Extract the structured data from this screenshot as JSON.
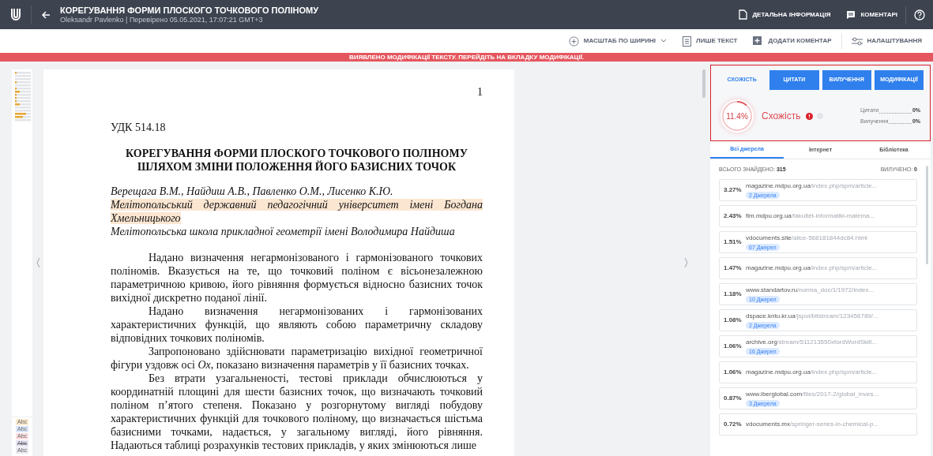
{
  "header": {
    "title": "КОРЕГУВАННЯ ФОРМИ ПЛОСКОГО ТОЧКОВОГО ПОЛІНОМУ",
    "subtitle": "Oleksandr Pavlenko | Перевірено 05.05.2021, 17:07:21 GMT+3",
    "actions": [
      "ДЕТАЛЬНА ІНФОРМАЦІЯ",
      "КОМЕНТАРІ"
    ]
  },
  "toolbar": [
    {
      "kind": "zoom",
      "label": "МАСШТАБ ПО ШИРИНІ"
    },
    {
      "kind": "text",
      "label": "ЛИШЕ ТЕКСТ"
    },
    {
      "kind": "comment",
      "label": "ДОДАТИ КОМЕНТАР"
    },
    {
      "kind": "settings",
      "label": "НАЛАШТУВАННЯ"
    }
  ],
  "banner": "ВИЯВЛЕНО МОДИФІКАЦІЇ ТЕКСТУ. ПЕРЕЙДІТЬ НА ВКЛАДКУ МОДИФІКАЦІЇ.",
  "legend": [
    {
      "label": "Abc",
      "kind": "similar"
    },
    {
      "label": "Abc",
      "kind": "quote"
    },
    {
      "label": "Abc",
      "kind": "modified"
    },
    {
      "label": "Abc",
      "kind": "excluded"
    },
    {
      "label": "Abc",
      "kind": "other"
    }
  ],
  "document": {
    "page_number": "1",
    "udc": "УДК 514.18",
    "title_lines": [
      "КОРЕГУВАННЯ ФОРМИ ПЛОСКОГО ТОЧКОВОГО ПОЛІНОМУ",
      "ШЛЯХОМ ЗМІНИ ПОЛОЖЕННЯ ЙОГО БАЗИСНИХ ТОЧОК"
    ],
    "affiliations": [
      {
        "text": "Верещага В.М., Найдиш А.В., Павленко О.М., Лисенко К.Ю.",
        "highlighted": false
      },
      {
        "text": "Мелітопольський державний педагогічний університет імені Богдана Хмельницького",
        "highlighted": true
      },
      {
        "text": "Мелітопольська школа прикладної геометрії імені Володимира Найдиша",
        "highlighted": false
      }
    ],
    "paragraphs": [
      "Надано визначення негармонізованого і гармонізованого точкових поліномів. Вказується на те, що точковий поліном є вісьонезалежною параметричною кривою, його рівняння формується відносно базисних точок вихідної дискретно поданої лінії.",
      "Надано визначення негармонізованих і гармонізованих характеристичних функцій, що являють собою параметричну складову відповідних точкових поліномів.",
      "Запропоновано здійснювати параметризацію вихідної геометричної фігури уздовж осі *Ox*, показано визначення параметрів у її базисних точках.",
      "Без втрати узагальненості, тестові приклади обчислюються у координатній площині для шести базисних точок, що визначають точковий поліном п’ятого степеня. Показано у розгорнутому вигляді побудову характеристичних функцій для точкового поліному, що визначається шістьма базисними точками, надається, у загальному вигляді, його рівняння. Надаються таблиці розрахунків тестових прикладів, у яких змінюються лише"
    ]
  },
  "report": {
    "tabs": [
      {
        "label": "СХОЖІСТЬ",
        "selected": true
      },
      {
        "label": "ЦИТАТИ",
        "selected": false
      },
      {
        "label": "ВИЛУЧЕННЯ",
        "selected": false
      },
      {
        "label": "МОДИФІКАЦІЇ",
        "selected": false
      }
    ],
    "score": {
      "value": "11.4%",
      "level": 0.114,
      "label": "Схожість"
    },
    "stats": [
      {
        "label": "Цитати",
        "value": "0%"
      },
      {
        "label": "Вилучення",
        "value": "0%"
      }
    ],
    "source_tabs": [
      {
        "label": "Всі джерела",
        "selected": true
      },
      {
        "label": "Інтернет",
        "selected": false
      },
      {
        "label": "Бібліотека",
        "selected": false
      }
    ],
    "found": {
      "label": "ВСЬОГО ЗНАЙДЕНО:",
      "value": "315"
    },
    "excluded": {
      "label": "ВИЛУЧЕНО:",
      "value": "0"
    },
    "sources": [
      {
        "percent": "3.27%",
        "domain": "magazine.mdpu.org.ua",
        "path": "/index.php/spm/article...",
        "badge": "2 Джерела"
      },
      {
        "percent": "2.43%",
        "domain": "fim.mdpu.org.ua",
        "path": "/fakultet-informatiki-matema..."
      },
      {
        "percent": "1.51%",
        "domain": "vdocuments.site",
        "path": "/alice-568181844dc84.html",
        "badge": "67 Джерел"
      },
      {
        "percent": "1.47%",
        "domain": "magazine.mdpu.org.ua",
        "path": "/index.php/spm/article..."
      },
      {
        "percent": "1.18%",
        "domain": "www.standartov.ru",
        "path": "/norma_doc/1/1972/index...",
        "badge": "10 Джерел"
      },
      {
        "percent": "1.08%",
        "domain": "dspace.kntu.kr.ua",
        "path": "/jspui/bitstream/123456789/...",
        "badge": "2 Джерела"
      },
      {
        "percent": "1.06%",
        "domain": "archive.org",
        "path": "/stream/511213550xfordWordSkill...",
        "badge": "16 Джерел"
      },
      {
        "percent": "1.06%",
        "domain": "magazine.mdpu.org.ua",
        "path": "/index.php/spm/article..."
      },
      {
        "percent": "0.87%",
        "domain": "www.iberglobal.com",
        "path": "/files/2017-2/global_inves...",
        "badge": "3 Джерела"
      },
      {
        "percent": "0.72%",
        "domain": "vdocuments.mx",
        "path": "/springer-series-in-chemical-p..."
      }
    ]
  }
}
